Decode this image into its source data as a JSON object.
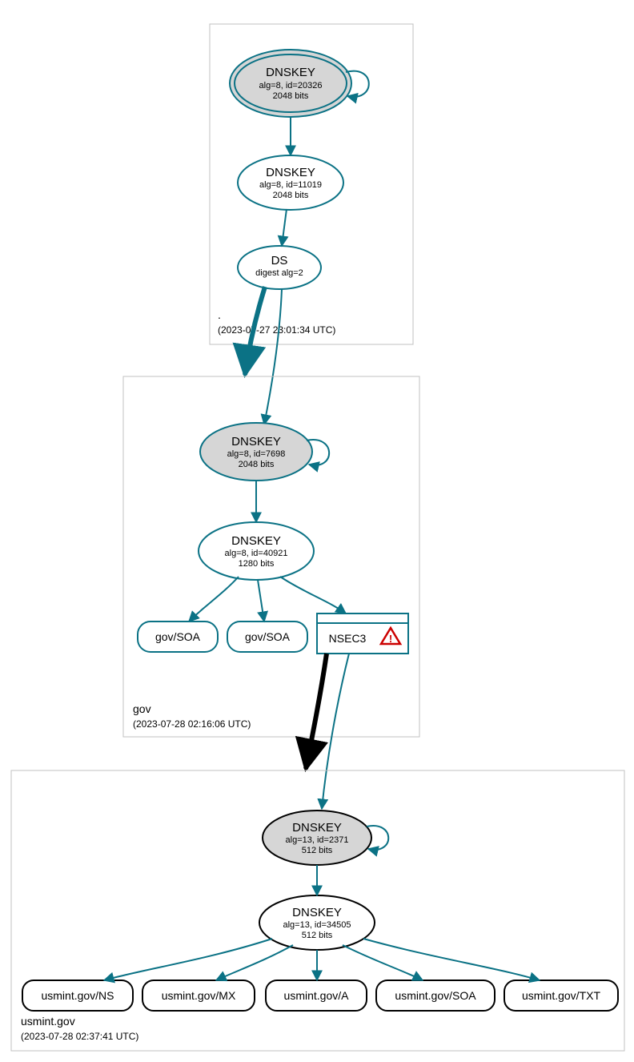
{
  "colors": {
    "teal": "#0b7285",
    "black": "#000000",
    "gray": "#d6d6d6",
    "lightgray": "#c0c0c0"
  },
  "zones": {
    "root": {
      "label": ".",
      "timestamp": "(2023-07-27 23:01:34 UTC)",
      "dnskey1": {
        "title": "DNSKEY",
        "line1": "alg=8, id=20326",
        "line2": "2048 bits"
      },
      "dnskey2": {
        "title": "DNSKEY",
        "line1": "alg=8, id=11019",
        "line2": "2048 bits"
      },
      "ds": {
        "title": "DS",
        "line1": "digest alg=2"
      }
    },
    "gov": {
      "label": "gov",
      "timestamp": "(2023-07-28 02:16:06 UTC)",
      "dnskey1": {
        "title": "DNSKEY",
        "line1": "alg=8, id=7698",
        "line2": "2048 bits"
      },
      "dnskey2": {
        "title": "DNSKEY",
        "line1": "alg=8, id=40921",
        "line2": "1280 bits"
      },
      "soa1": "gov/SOA",
      "soa2": "gov/SOA",
      "nsec3": "NSEC3"
    },
    "usmint": {
      "label": "usmint.gov",
      "timestamp": "(2023-07-28 02:37:41 UTC)",
      "dnskey1": {
        "title": "DNSKEY",
        "line1": "alg=13, id=2371",
        "line2": "512 bits"
      },
      "dnskey2": {
        "title": "DNSKEY",
        "line1": "alg=13, id=34505",
        "line2": "512 bits"
      },
      "rr1": "usmint.gov/NS",
      "rr2": "usmint.gov/MX",
      "rr3": "usmint.gov/A",
      "rr4": "usmint.gov/SOA",
      "rr5": "usmint.gov/TXT"
    }
  }
}
